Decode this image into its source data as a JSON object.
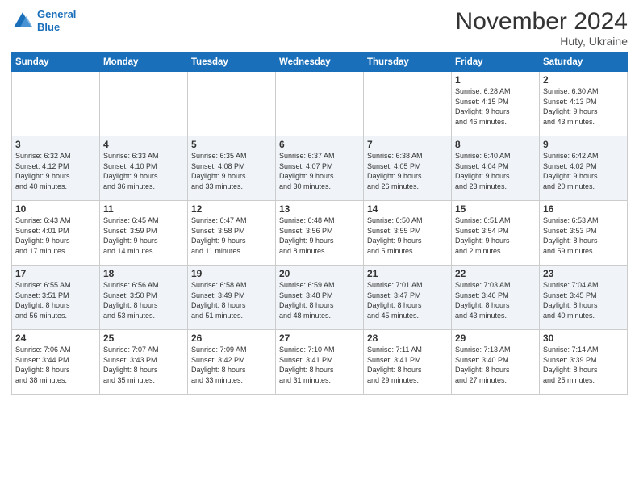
{
  "logo": {
    "line1": "General",
    "line2": "Blue"
  },
  "title": "November 2024",
  "subtitle": "Huty, Ukraine",
  "days_header": [
    "Sunday",
    "Monday",
    "Tuesday",
    "Wednesday",
    "Thursday",
    "Friday",
    "Saturday"
  ],
  "weeks": [
    [
      {
        "num": "",
        "detail": ""
      },
      {
        "num": "",
        "detail": ""
      },
      {
        "num": "",
        "detail": ""
      },
      {
        "num": "",
        "detail": ""
      },
      {
        "num": "",
        "detail": ""
      },
      {
        "num": "1",
        "detail": "Sunrise: 6:28 AM\nSunset: 4:15 PM\nDaylight: 9 hours\nand 46 minutes."
      },
      {
        "num": "2",
        "detail": "Sunrise: 6:30 AM\nSunset: 4:13 PM\nDaylight: 9 hours\nand 43 minutes."
      }
    ],
    [
      {
        "num": "3",
        "detail": "Sunrise: 6:32 AM\nSunset: 4:12 PM\nDaylight: 9 hours\nand 40 minutes."
      },
      {
        "num": "4",
        "detail": "Sunrise: 6:33 AM\nSunset: 4:10 PM\nDaylight: 9 hours\nand 36 minutes."
      },
      {
        "num": "5",
        "detail": "Sunrise: 6:35 AM\nSunset: 4:08 PM\nDaylight: 9 hours\nand 33 minutes."
      },
      {
        "num": "6",
        "detail": "Sunrise: 6:37 AM\nSunset: 4:07 PM\nDaylight: 9 hours\nand 30 minutes."
      },
      {
        "num": "7",
        "detail": "Sunrise: 6:38 AM\nSunset: 4:05 PM\nDaylight: 9 hours\nand 26 minutes."
      },
      {
        "num": "8",
        "detail": "Sunrise: 6:40 AM\nSunset: 4:04 PM\nDaylight: 9 hours\nand 23 minutes."
      },
      {
        "num": "9",
        "detail": "Sunrise: 6:42 AM\nSunset: 4:02 PM\nDaylight: 9 hours\nand 20 minutes."
      }
    ],
    [
      {
        "num": "10",
        "detail": "Sunrise: 6:43 AM\nSunset: 4:01 PM\nDaylight: 9 hours\nand 17 minutes."
      },
      {
        "num": "11",
        "detail": "Sunrise: 6:45 AM\nSunset: 3:59 PM\nDaylight: 9 hours\nand 14 minutes."
      },
      {
        "num": "12",
        "detail": "Sunrise: 6:47 AM\nSunset: 3:58 PM\nDaylight: 9 hours\nand 11 minutes."
      },
      {
        "num": "13",
        "detail": "Sunrise: 6:48 AM\nSunset: 3:56 PM\nDaylight: 9 hours\nand 8 minutes."
      },
      {
        "num": "14",
        "detail": "Sunrise: 6:50 AM\nSunset: 3:55 PM\nDaylight: 9 hours\nand 5 minutes."
      },
      {
        "num": "15",
        "detail": "Sunrise: 6:51 AM\nSunset: 3:54 PM\nDaylight: 9 hours\nand 2 minutes."
      },
      {
        "num": "16",
        "detail": "Sunrise: 6:53 AM\nSunset: 3:53 PM\nDaylight: 8 hours\nand 59 minutes."
      }
    ],
    [
      {
        "num": "17",
        "detail": "Sunrise: 6:55 AM\nSunset: 3:51 PM\nDaylight: 8 hours\nand 56 minutes."
      },
      {
        "num": "18",
        "detail": "Sunrise: 6:56 AM\nSunset: 3:50 PM\nDaylight: 8 hours\nand 53 minutes."
      },
      {
        "num": "19",
        "detail": "Sunrise: 6:58 AM\nSunset: 3:49 PM\nDaylight: 8 hours\nand 51 minutes."
      },
      {
        "num": "20",
        "detail": "Sunrise: 6:59 AM\nSunset: 3:48 PM\nDaylight: 8 hours\nand 48 minutes."
      },
      {
        "num": "21",
        "detail": "Sunrise: 7:01 AM\nSunset: 3:47 PM\nDaylight: 8 hours\nand 45 minutes."
      },
      {
        "num": "22",
        "detail": "Sunrise: 7:03 AM\nSunset: 3:46 PM\nDaylight: 8 hours\nand 43 minutes."
      },
      {
        "num": "23",
        "detail": "Sunrise: 7:04 AM\nSunset: 3:45 PM\nDaylight: 8 hours\nand 40 minutes."
      }
    ],
    [
      {
        "num": "24",
        "detail": "Sunrise: 7:06 AM\nSunset: 3:44 PM\nDaylight: 8 hours\nand 38 minutes."
      },
      {
        "num": "25",
        "detail": "Sunrise: 7:07 AM\nSunset: 3:43 PM\nDaylight: 8 hours\nand 35 minutes."
      },
      {
        "num": "26",
        "detail": "Sunrise: 7:09 AM\nSunset: 3:42 PM\nDaylight: 8 hours\nand 33 minutes."
      },
      {
        "num": "27",
        "detail": "Sunrise: 7:10 AM\nSunset: 3:41 PM\nDaylight: 8 hours\nand 31 minutes."
      },
      {
        "num": "28",
        "detail": "Sunrise: 7:11 AM\nSunset: 3:41 PM\nDaylight: 8 hours\nand 29 minutes."
      },
      {
        "num": "29",
        "detail": "Sunrise: 7:13 AM\nSunset: 3:40 PM\nDaylight: 8 hours\nand 27 minutes."
      },
      {
        "num": "30",
        "detail": "Sunrise: 7:14 AM\nSunset: 3:39 PM\nDaylight: 8 hours\nand 25 minutes."
      }
    ]
  ]
}
